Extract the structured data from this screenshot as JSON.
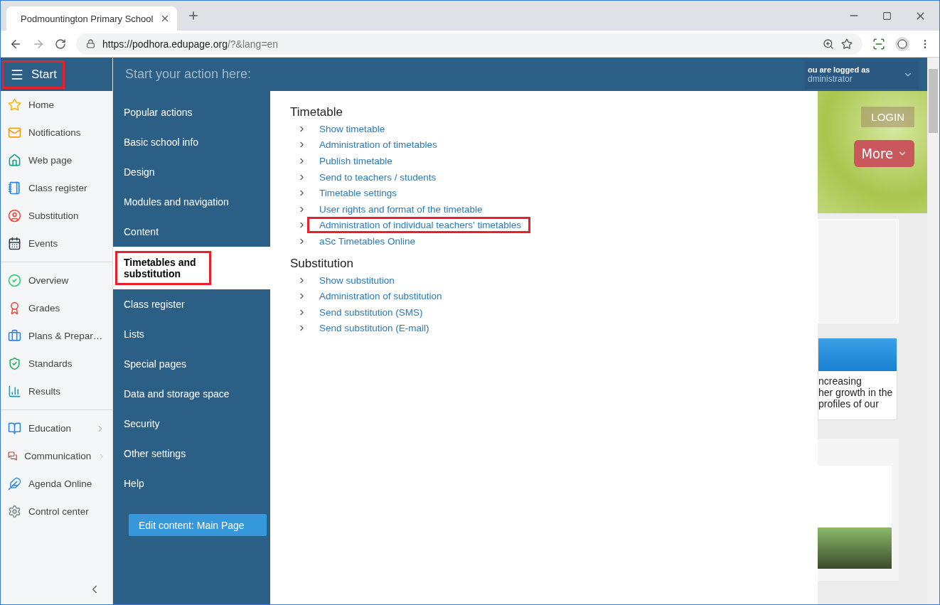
{
  "browser": {
    "tab_title": "Podmountington Primary School",
    "url_host": "https://podhora.edupage.org",
    "url_rest": "/?&lang=en"
  },
  "start_button": {
    "label": "Start",
    "highlighted": true
  },
  "header": {
    "prompt": "Start your action here:",
    "logged_as": "ou are logged as",
    "user": "dministrator"
  },
  "sidebar": {
    "groups": [
      [
        {
          "label": "Home",
          "has_submenu": false
        },
        {
          "label": "Notifications",
          "has_submenu": false
        },
        {
          "label": "Web page",
          "has_submenu": false
        },
        {
          "label": "Class register",
          "has_submenu": false
        },
        {
          "label": "Substitution",
          "has_submenu": false
        },
        {
          "label": "Events",
          "has_submenu": false
        }
      ],
      [
        {
          "label": "Overview",
          "has_submenu": false
        },
        {
          "label": "Grades",
          "has_submenu": false
        },
        {
          "label": "Plans & Prepar…",
          "has_submenu": false
        },
        {
          "label": "Standards",
          "has_submenu": false
        },
        {
          "label": "Results",
          "has_submenu": false
        }
      ],
      [
        {
          "label": "Education",
          "has_submenu": true
        },
        {
          "label": "Communication",
          "has_submenu": true
        },
        {
          "label": "Agenda Online",
          "has_submenu": false
        },
        {
          "label": "Control center",
          "has_submenu": false
        }
      ]
    ]
  },
  "categories": [
    {
      "label": "Popular actions",
      "selected": false,
      "highlighted": false
    },
    {
      "label": "Basic school info",
      "selected": false,
      "highlighted": false
    },
    {
      "label": "Design",
      "selected": false,
      "highlighted": false
    },
    {
      "label": "Modules and navigation",
      "selected": false,
      "highlighted": false
    },
    {
      "label": "Content",
      "selected": false,
      "highlighted": false
    },
    {
      "label": "Timetables and substitution",
      "selected": true,
      "highlighted": true
    },
    {
      "label": "Class register",
      "selected": false,
      "highlighted": false
    },
    {
      "label": "Lists",
      "selected": false,
      "highlighted": false
    },
    {
      "label": "Special pages",
      "selected": false,
      "highlighted": false
    },
    {
      "label": "Data and storage space",
      "selected": false,
      "highlighted": false
    },
    {
      "label": "Security",
      "selected": false,
      "highlighted": false
    },
    {
      "label": "Other settings",
      "selected": false,
      "highlighted": false
    },
    {
      "label": "Help",
      "selected": false,
      "highlighted": false
    }
  ],
  "edit_button": "Edit content: Main Page",
  "sections": [
    {
      "title": "Timetable",
      "links": [
        {
          "label": "Show timetable",
          "highlighted": false
        },
        {
          "label": "Administration of timetables",
          "highlighted": false
        },
        {
          "label": "Publish timetable",
          "highlighted": false
        },
        {
          "label": "Send to teachers / students",
          "highlighted": false
        },
        {
          "label": "Timetable settings",
          "highlighted": false
        },
        {
          "label": "User rights and format of the timetable",
          "highlighted": false
        },
        {
          "label": "Administration of individual teachers' timetables",
          "highlighted": true
        },
        {
          "label": "aSc Timetables Online",
          "highlighted": false
        }
      ]
    },
    {
      "title": "Substitution",
      "links": [
        {
          "label": "Show substitution",
          "highlighted": false
        },
        {
          "label": "Administration of substitution",
          "highlighted": false
        },
        {
          "label": "Send substitution (SMS)",
          "highlighted": false
        },
        {
          "label": "Send substitution (E-mail)",
          "highlighted": false
        }
      ]
    }
  ],
  "website": {
    "login": "LOGIN",
    "more": "More",
    "card_lines": [
      "ncreasing",
      "her growth in the",
      "profiles of our"
    ]
  }
}
